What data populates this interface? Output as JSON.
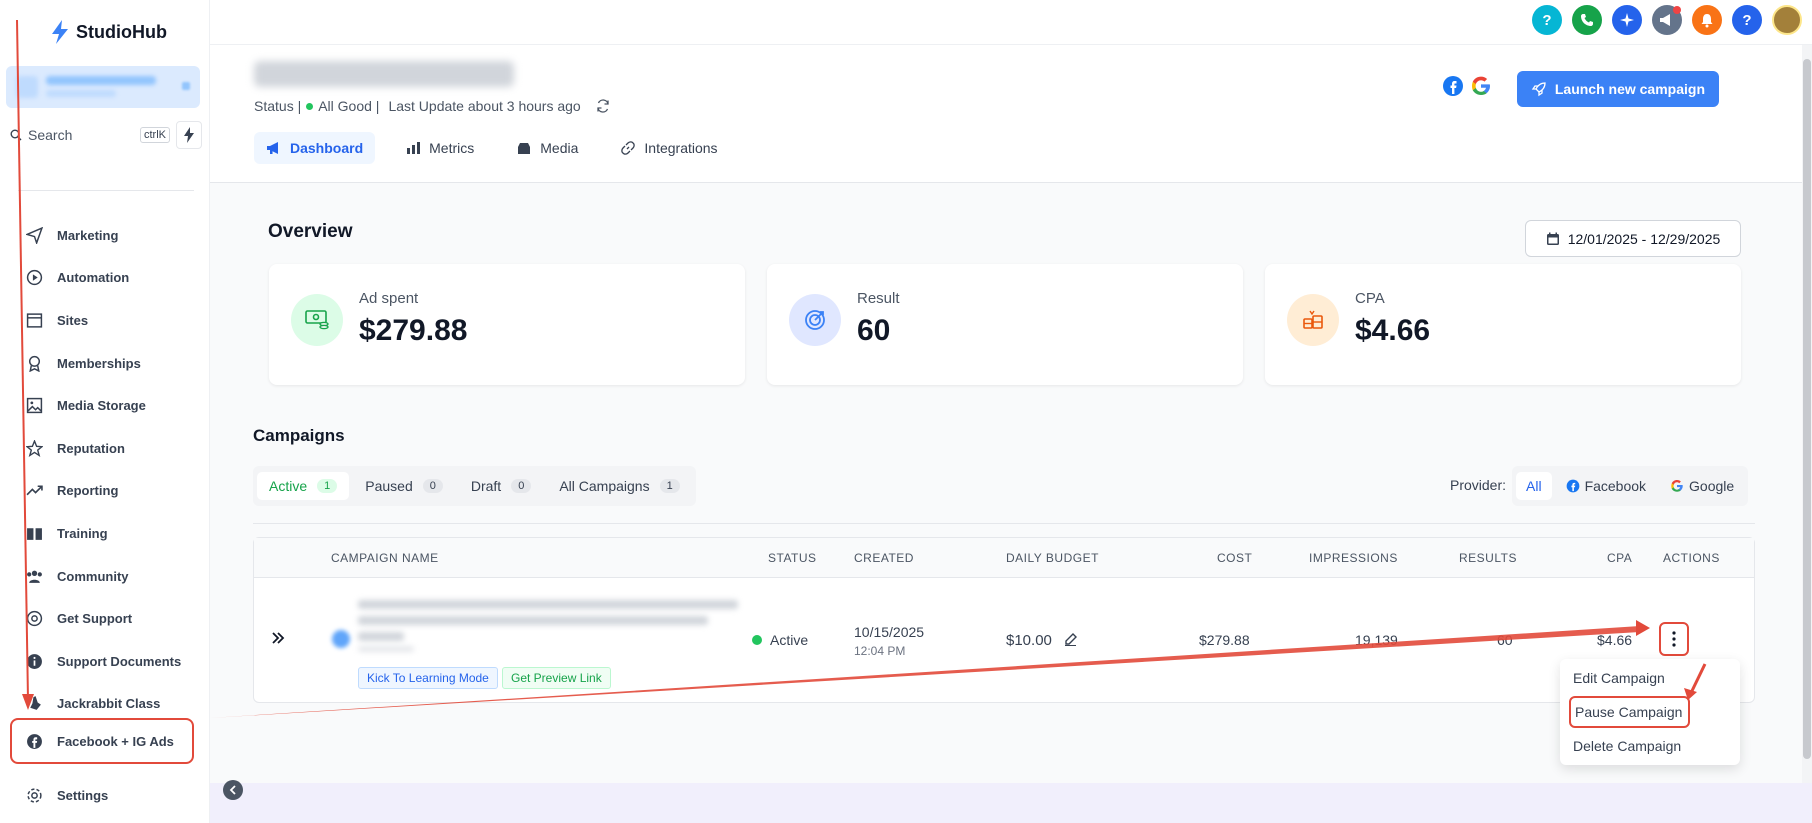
{
  "app": {
    "logo_text": "StudioHub"
  },
  "sidebar": {
    "search_placeholder": "Search",
    "search_shortcut": "ctrlK",
    "items": [
      {
        "label": "Marketing",
        "icon": "send-icon"
      },
      {
        "label": "Automation",
        "icon": "automation-icon"
      },
      {
        "label": "Sites",
        "icon": "sites-icon"
      },
      {
        "label": "Memberships",
        "icon": "badge-icon"
      },
      {
        "label": "Media Storage",
        "icon": "image-icon"
      },
      {
        "label": "Reputation",
        "icon": "star-icon"
      },
      {
        "label": "Reporting",
        "icon": "trend-icon"
      },
      {
        "label": "Training",
        "icon": "book-icon"
      },
      {
        "label": "Community",
        "icon": "users-icon"
      },
      {
        "label": "Get Support",
        "icon": "lifebuoy-icon"
      },
      {
        "label": "Support Documents",
        "icon": "info-icon"
      },
      {
        "label": "Jackrabbit Class",
        "icon": "rabbit-icon"
      }
    ],
    "highlighted_item": "Facebook + IG Ads",
    "settings_label": "Settings"
  },
  "header": {
    "status_text": "Status |",
    "status_value": "All Good |",
    "last_update": "Last Update about 3 hours ago",
    "tabs": [
      "Dashboard",
      "Metrics",
      "Media",
      "Integrations"
    ],
    "launch_label": "Launch new campaign"
  },
  "overview": {
    "title": "Overview",
    "date_range": "12/01/2025 - 12/29/2025",
    "cards": [
      {
        "label": "Ad spent",
        "value": "$279.88"
      },
      {
        "label": "Result",
        "value": "60"
      },
      {
        "label": "CPA",
        "value": "$4.66"
      }
    ]
  },
  "campaigns": {
    "title": "Campaigns",
    "tabs": [
      {
        "label": "Active",
        "count": "1"
      },
      {
        "label": "Paused",
        "count": "0"
      },
      {
        "label": "Draft",
        "count": "0"
      },
      {
        "label": "All Campaigns",
        "count": "1"
      }
    ],
    "provider_label": "Provider:",
    "providers": [
      "All",
      "Facebook",
      "Google"
    ],
    "columns": [
      "CAMPAIGN NAME",
      "STATUS",
      "CREATED",
      "DAILY BUDGET",
      "COST",
      "IMPRESSIONS",
      "RESULTS",
      "CPA",
      "ACTIONS"
    ],
    "row": {
      "status": "Active",
      "created_date": "10/15/2025",
      "created_time": "12:04 PM",
      "daily_budget": "$10.00",
      "cost": "$279.88",
      "impressions": "19,139",
      "results": "60",
      "cpa": "$4.66",
      "pill_learning": "Kick To Learning Mode",
      "pill_preview": "Get Preview Link"
    },
    "menu": [
      "Edit Campaign",
      "Pause Campaign",
      "Delete Campaign"
    ]
  },
  "colors": {
    "accent": "#3b82f6",
    "annotation": "#e24a3b",
    "success": "#22c55e"
  }
}
